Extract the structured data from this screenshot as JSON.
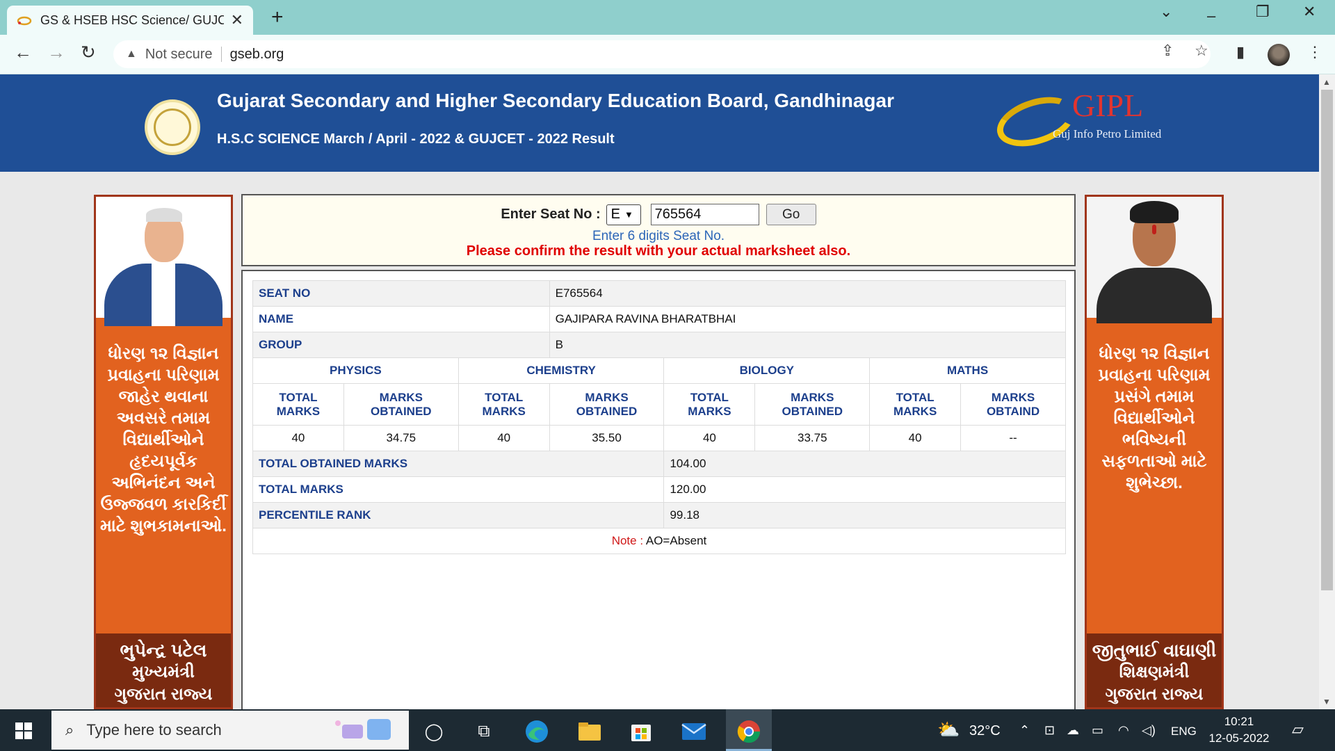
{
  "browser": {
    "tab_title": "GS & HSEB HSC Science/ GUJCET",
    "tab_close": "✕",
    "new_tab": "+",
    "security_label": "Not secure",
    "url": "gseb.org"
  },
  "header": {
    "title": "Gujarat Secondary and Higher Secondary Education Board, Gandhinagar",
    "subtitle": "H.S.C SCIENCE March / April - 2022 & GUJCET - 2022 Result",
    "sponsor_name": "GIPL",
    "sponsor_full": "Guj Info Petro Limited"
  },
  "left_banner": {
    "message": "ધોરણ ૧૨ વિજ્ઞાન પ્રવાહના પરિણામ જાહેર થવાના અવસરે તમામ વિદ્યાર્થીઓને હૃદયપૂર્વક અભિનંદન અને ઉજ્જવળ કારકિર્દી માટે શુભકામનાઓ.",
    "name": "ભુપેન્દ્ર પટેલ",
    "role": "મુખ્યમંત્રી",
    "state": "ગુજરાત રાજ્ય"
  },
  "right_banner": {
    "message": "ધોરણ ૧૨ વિજ્ઞાન પ્રવાહના પરિણામ પ્રસંગે તમામ વિદ્યાર્થીઓને ભવિષ્યની સફળતાઓ માટે શુભેચ્છા.",
    "name": "જીતુભાઈ વાઘાણી",
    "role": "શિક્ષણમંત્રી",
    "state": "ગુજરાત રાજ્ય"
  },
  "form": {
    "label": "Enter Seat No :",
    "series_value": "E",
    "seat_value": "765564",
    "go_label": "Go",
    "hint": "Enter 6 digits Seat No.",
    "warning": "Please confirm the result with your actual marksheet also."
  },
  "result": {
    "seat_label": "SEAT NO",
    "seat_value": "E765564",
    "name_label": "NAME",
    "name_value": "GAJIPARA RAVINA BHARATBHAI",
    "group_label": "GROUP",
    "group_value": "B",
    "subjects": [
      {
        "name": "PHYSICS",
        "col1": "TOTAL MARKS",
        "col2": "MARKS OBTAINED",
        "total": "40",
        "obtained": "34.75"
      },
      {
        "name": "CHEMISTRY",
        "col1": "TOTAL MARKS",
        "col2": "MARKS OBTAINED",
        "total": "40",
        "obtained": "35.50"
      },
      {
        "name": "BIOLOGY",
        "col1": "TOTAL MARKS",
        "col2": "MARKS OBTAINED",
        "total": "40",
        "obtained": "33.75"
      },
      {
        "name": "MATHS",
        "col1": "TOTAL MARKS",
        "col2": "MARKS OBTAIND",
        "total": "40",
        "obtained": "--"
      }
    ],
    "total_obtained_label": "TOTAL OBTAINED MARKS",
    "total_obtained_value": "104.00",
    "total_marks_label": "TOTAL MARKS",
    "total_marks_value": "120.00",
    "percentile_label": "PERCENTILE RANK",
    "percentile_value": "99.18",
    "note_label": "Note :",
    "note_text": "AO=Absent"
  },
  "taskbar": {
    "search_placeholder": "Type here to search",
    "temperature": "32°C",
    "language": "ENG",
    "time": "10:21",
    "date": "12-05-2022"
  },
  "colors": {
    "header_blue": "#1f4f96",
    "banner_orange": "#e2621f",
    "label_blue": "#1c3f8c",
    "warning_red": "#e00000",
    "hint_blue": "#2c66b8"
  }
}
